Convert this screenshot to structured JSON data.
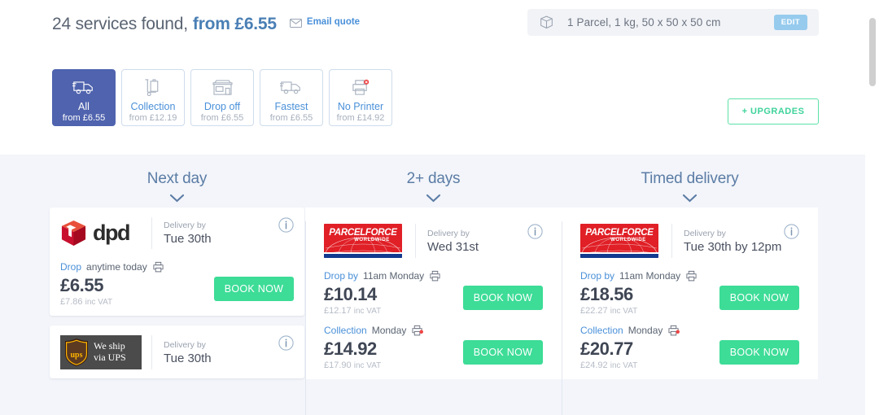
{
  "header": {
    "services_found": "24 services found,",
    "from_price": "from £6.55",
    "email_quote_label": "Email quote",
    "parcel_summary": "1 Parcel, 1 kg, 50 x 50 x 50 cm",
    "edit_label": "EDIT",
    "upgrades_label": "+ UPGRADES"
  },
  "filters": [
    {
      "label": "All",
      "sub": "from £6.55",
      "icon": "van-icon",
      "active": true
    },
    {
      "label": "Collection",
      "sub": "from £12.19",
      "icon": "trolley-icon",
      "active": false
    },
    {
      "label": "Drop off",
      "sub": "from £6.55",
      "icon": "shop-icon",
      "active": false
    },
    {
      "label": "Fastest",
      "sub": "from £6.55",
      "icon": "van-icon",
      "active": false
    },
    {
      "label": "No Printer",
      "sub": "from £14.92",
      "icon": "no-printer-icon",
      "active": false
    }
  ],
  "columns": [
    {
      "title": "Next day",
      "cards": [
        {
          "carrier": "dpd",
          "logo": "dpd-logo",
          "delivery_label": "Delivery by",
          "delivery_date": "Tue 30th",
          "options": [
            {
              "type": "Drop",
              "when": "anytime today",
              "printer": "printer-icon",
              "price": "£6.55",
              "vat": "£7.86",
              "vat_suffix": "inc VAT",
              "book_label": "BOOK NOW"
            }
          ]
        },
        {
          "carrier": "ups",
          "logo": "ups-logo",
          "logo_line1": "We ship",
          "logo_line2": "via UPS",
          "delivery_label": "Delivery by",
          "delivery_date": "Tue 30th",
          "options": []
        }
      ]
    },
    {
      "title": "2+ days",
      "cards": [
        {
          "carrier": "parcelforce",
          "logo": "parcelforce-logo",
          "logo_text": "PARCELFORCE",
          "logo_sub": "WORLDWIDE",
          "delivery_label": "Delivery by",
          "delivery_date": "Wed 31st",
          "options": [
            {
              "type": "Drop by",
              "when": "11am Monday",
              "printer": "printer-icon",
              "price": "£10.14",
              "vat": "£12.17",
              "vat_suffix": "inc VAT",
              "book_label": "BOOK NOW"
            },
            {
              "type": "Collection",
              "when": "Monday",
              "printer": "no-printer-icon",
              "price": "£14.92",
              "vat": "£17.90",
              "vat_suffix": "inc VAT",
              "book_label": "BOOK NOW"
            }
          ]
        }
      ]
    },
    {
      "title": "Timed delivery",
      "cards": [
        {
          "carrier": "parcelforce",
          "logo": "parcelforce-logo",
          "logo_text": "PARCELFORCE",
          "logo_sub": "WORLDWIDE",
          "delivery_label": "Delivery by",
          "delivery_date": "Tue 30th by 12pm",
          "options": [
            {
              "type": "Drop by",
              "when": "11am Monday",
              "printer": "printer-icon",
              "price": "£18.56",
              "vat": "£22.27",
              "vat_suffix": "inc VAT",
              "book_label": "BOOK NOW"
            },
            {
              "type": "Collection",
              "when": "Monday",
              "printer": "no-printer-icon",
              "price": "£20.77",
              "vat": "£24.92",
              "vat_suffix": "inc VAT",
              "book_label": "BOOK NOW"
            }
          ]
        }
      ]
    }
  ],
  "colors": {
    "accent_blue": "#4a90d9",
    "active_tab": "#4f63ae",
    "book_green": "#3ddc97",
    "upgrade_green": "#3ed39b",
    "page_bg": "#f3f5fa"
  }
}
